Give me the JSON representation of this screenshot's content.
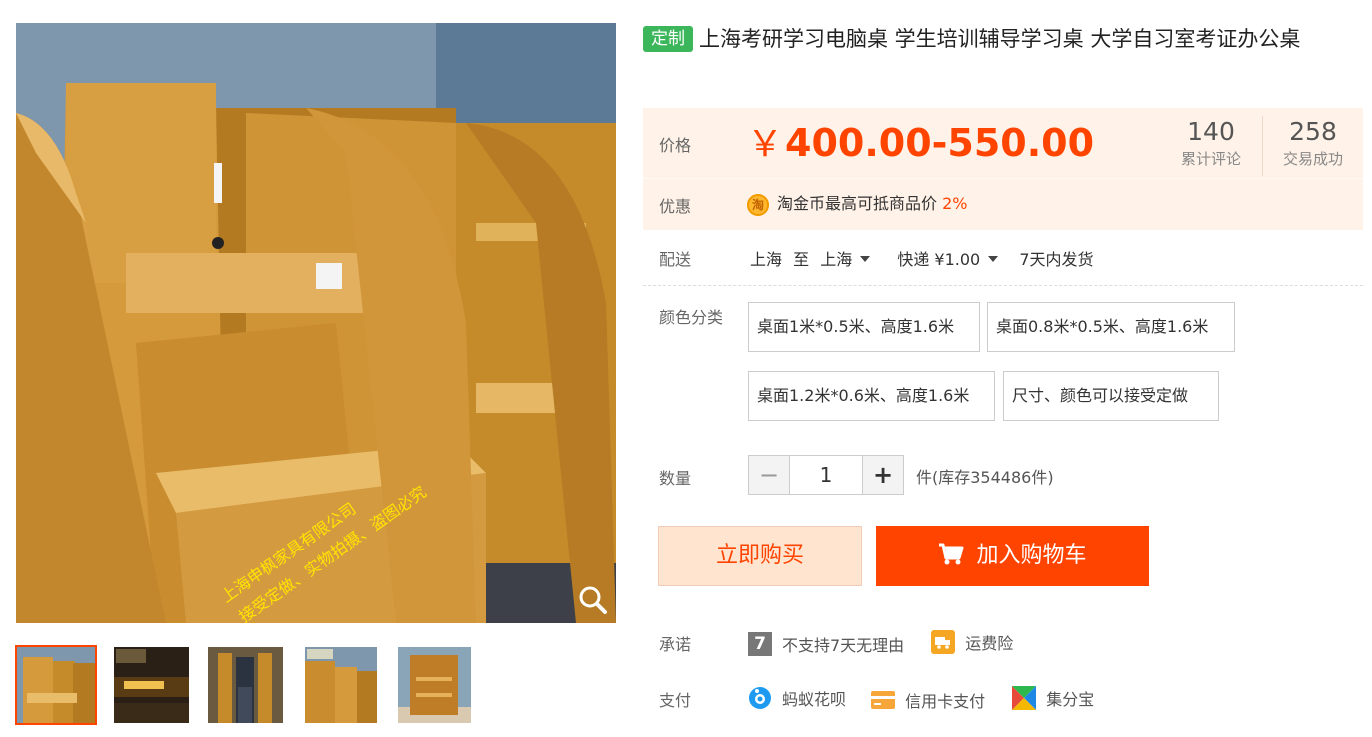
{
  "product": {
    "tag": "定制",
    "title": "上海考研学习电脑桌 学生培训辅导学习桌 大学自习室考证办公桌",
    "watermark_line1": "上海申枫家具有限公司",
    "watermark_line2": "接受定做、实物拍摄、盗图必究"
  },
  "price": {
    "label": "价格",
    "currency": "￥",
    "range": "400.00-550.00",
    "reviews_count": "140",
    "reviews_label": "累计评论",
    "sales_count": "258",
    "sales_label": "交易成功"
  },
  "promo": {
    "label": "优惠",
    "coin_icon": "淘",
    "text": "淘金币最高可抵商品价",
    "percent": "2%"
  },
  "delivery": {
    "label": "配送",
    "from": "上海",
    "to_word": "至",
    "to": "上海",
    "method": "快递 ¥1.00",
    "ship_time": "7天内发货"
  },
  "options": {
    "label": "颜色分类",
    "items": [
      "桌面1米*0.5米、高度1.6米",
      "桌面0.8米*0.5米、高度1.6米",
      "桌面1.2米*0.6米、高度1.6米",
      "尺寸、颜色可以接受定做"
    ]
  },
  "quantity": {
    "label": "数量",
    "minus": "−",
    "value": "1",
    "plus": "+",
    "stock_text": "件(库存354486件)"
  },
  "buttons": {
    "buy_now": "立即购买",
    "add_to_cart": "加入购物车"
  },
  "promise": {
    "label": "承诺",
    "no_return": "不支持7天无理由",
    "no_return_icon": "7",
    "shipping_insurance": "运费险"
  },
  "payment": {
    "label": "支付",
    "huabei": "蚂蚁花呗",
    "credit_card": "信用卡支付",
    "jifenbao": "集分宝"
  },
  "colors": {
    "accent": "#ff4400",
    "tag_green": "#3cb65b",
    "price_bg": "#fff2e8"
  }
}
